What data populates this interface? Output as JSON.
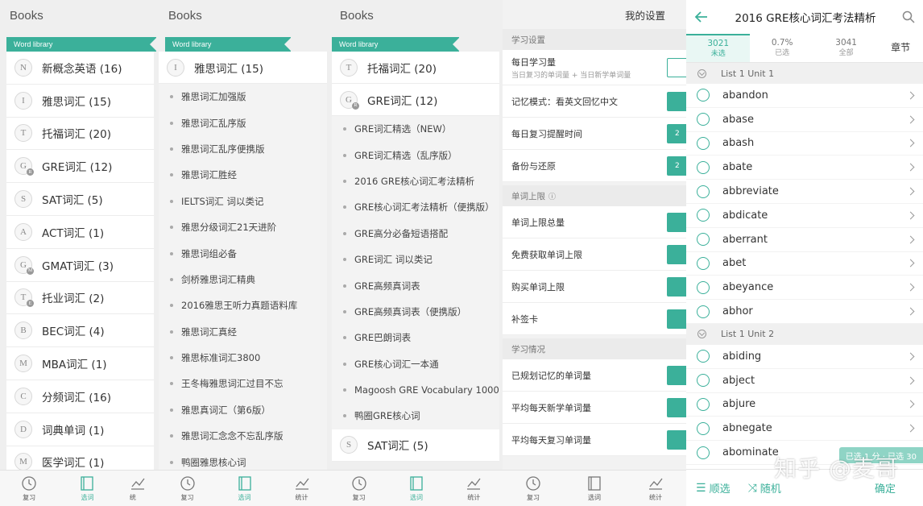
{
  "panel1": {
    "title": "Books",
    "tag": "Word library",
    "items": [
      {
        "letter": "N",
        "label": "新概念英语 (16)"
      },
      {
        "letter": "I",
        "label": "雅思词汇 (15)"
      },
      {
        "letter": "T",
        "label": "托福词汇 (20)"
      },
      {
        "letter": "G",
        "mini": "R",
        "label": "GRE词汇 (12)"
      },
      {
        "letter": "S",
        "label": "SAT词汇 (5)"
      },
      {
        "letter": "A",
        "label": "ACT词汇 (1)"
      },
      {
        "letter": "G",
        "mini": "M",
        "label": "GMAT词汇 (3)"
      },
      {
        "letter": "T",
        "mini": "E",
        "label": "托业词汇 (2)"
      },
      {
        "letter": "B",
        "label": "BEC词汇 (4)"
      },
      {
        "letter": "M",
        "label": "MBA词汇 (1)"
      },
      {
        "letter": "C",
        "label": "分频词汇 (16)"
      },
      {
        "letter": "D",
        "label": "词典单词 (1)"
      },
      {
        "letter": "M",
        "label": "医学词汇 (1)"
      }
    ]
  },
  "panel2": {
    "title": "Books",
    "tag": "Word library",
    "head": {
      "letter": "I",
      "label": "雅思词汇 (15)"
    },
    "items": [
      "雅思词汇加强版",
      "雅思词汇乱序版",
      "雅思词汇乱序便携版",
      "雅思词汇胜经",
      "IELTS词汇 词以类记",
      "雅思分级词汇21天进阶",
      "雅思词组必备",
      "剑桥雅思词汇精典",
      "2016雅思王听力真题语料库",
      "雅思词汇真经",
      "雅思标准词汇3800",
      "王冬梅雅思词汇过目不忘",
      "雅思真词汇（第6版）",
      "雅思词汇念念不忘乱序版",
      "鸭圈雅思核心词"
    ]
  },
  "panel3": {
    "title": "Books",
    "tag": "Word library",
    "head1": {
      "letter": "T",
      "label": "托福词汇 (20)"
    },
    "head2": {
      "letter": "G",
      "mini": "R",
      "label": "GRE词汇 (12)"
    },
    "items": [
      "GRE词汇精选（NEW）",
      "GRE词汇精选（乱序版）",
      "2016 GRE核心词汇考法精析",
      "GRE核心词汇考法精析（便携版）",
      "GRE高分必备短语搭配",
      "GRE词汇 词以类记",
      "GRE高频真词表",
      "GRE高频真词表（便携版）",
      "GRE巴朗词表",
      "GRE核心词汇一本通",
      "Magoosh GRE Vocabulary 1000",
      "鸭圈GRE核心词"
    ],
    "tail": {
      "letter": "S",
      "label": "SAT词汇 (5)"
    }
  },
  "settings": {
    "title": "我的设置",
    "sec1": "学习设置",
    "daily": {
      "label": "每日学习量",
      "sub": "当日复习的单词量 + 当日新学单词量"
    },
    "memory": "记忆模式：看英文回忆中文",
    "remind": {
      "label": "每日复习提醒时间",
      "value": "2"
    },
    "backup": {
      "label": "备份与还原",
      "value": "2"
    },
    "sec2": "单词上限",
    "sec2_icon": "ⓘ",
    "limit_total": "单词上限总量",
    "limit_free": "免费获取单词上限",
    "limit_buy": "购买单词上限",
    "card": "补签卡",
    "sec3": "学习情况",
    "planned": "已规划记忆的单词量",
    "avg_new": "平均每天新学单词量",
    "avg_review": "平均每天复习单词量"
  },
  "wordlist": {
    "title": "2016 GRE核心词汇考法精析",
    "stats": [
      {
        "value": "3021",
        "label": "未选"
      },
      {
        "value": "0.7%",
        "label": "已选"
      },
      {
        "value": "3041",
        "label": "全部"
      }
    ],
    "chapter": "章节",
    "unit1": "List 1 Unit 1",
    "words1": [
      "abandon",
      "abase",
      "abash",
      "abate",
      "abbreviate",
      "abdicate",
      "aberrant",
      "abet",
      "abeyance",
      "abhor"
    ],
    "unit2": "List 1 Unit 2",
    "words2": [
      "abiding",
      "abject",
      "abjure",
      "abnegate",
      "abominate"
    ],
    "order_btn": "顺选",
    "random_btn": "随机",
    "confirm_btn": "确定",
    "selected_pill": "已选 1 分  · 已选 30",
    "watermark": "知乎 @麦哥"
  },
  "nav": {
    "review": "复习",
    "choose": "选词",
    "stats": "统计",
    "stats_short": "统"
  },
  "colors": {
    "accent": "#3bb09a"
  }
}
